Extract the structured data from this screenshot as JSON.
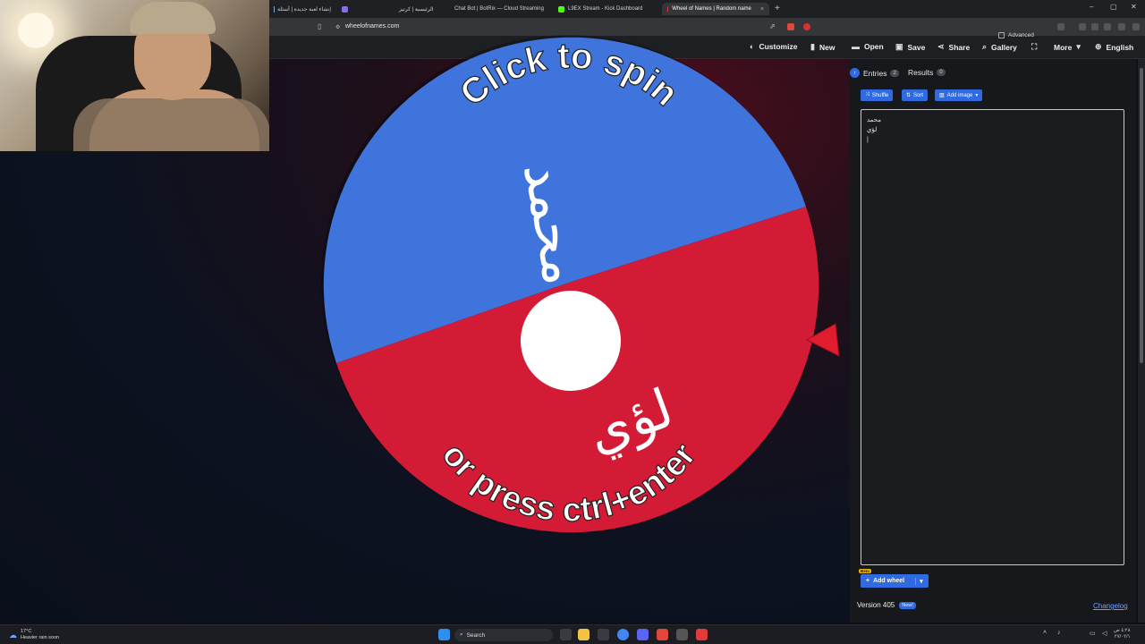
{
  "browser": {
    "tabs": [
      {
        "label": "إنشاء لعبة جديدة | أسئلة",
        "fav": "#7fa6e8"
      },
      {
        "label": "",
        "fav": "#8a6de9"
      },
      {
        "label": "الرئيسية | كرتيز",
        "fav": "#6e6e6e"
      },
      {
        "label": "Chat Bot | BotRix — Cloud Streaming",
        "fav": "#cfcfcf"
      },
      {
        "label": "L9EX Stream - Kick Dashboard",
        "fav": "#53fc18"
      },
      {
        "label": "Wheel of Names | Random name",
        "fav": "#e23a3a"
      }
    ],
    "active_tab_close": "×",
    "new_tab": "+",
    "url": "wheelofnames.com",
    "window_controls": [
      "–",
      "▢",
      "✕"
    ]
  },
  "header": {
    "items": [
      {
        "label": "Customize",
        "icon": "palette-icon",
        "glyph": "◐"
      },
      {
        "label": "New",
        "icon": "file-icon",
        "glyph": "▮"
      },
      {
        "label": "Open",
        "icon": "folder-icon",
        "glyph": "▬"
      },
      {
        "label": "Save",
        "icon": "save-icon",
        "glyph": "▣"
      },
      {
        "label": "Share",
        "icon": "share-icon",
        "glyph": "⋖"
      },
      {
        "label": "Gallery",
        "icon": "search-icon",
        "glyph": "⌕"
      },
      {
        "label": "",
        "icon": "fullscreen-icon",
        "glyph": "⛶"
      },
      {
        "label": "More",
        "icon": "chevron-down-icon",
        "glyph": "▾"
      },
      {
        "label": "English",
        "icon": "globe-icon",
        "glyph": "⊕"
      }
    ]
  },
  "wheel": {
    "top_text": "Click to spin",
    "bottom_text": "or press ctrl+enter",
    "segments": [
      {
        "name": "محمد",
        "color": "#3f74dc"
      },
      {
        "name": "لؤي",
        "color": "#d31b35"
      }
    ],
    "pointer_color": "#e01c2e"
  },
  "panel": {
    "tabs": [
      {
        "label": "Entries",
        "count": "2",
        "icon": "chevron-right-icon"
      },
      {
        "label": "Results",
        "count": "0"
      }
    ],
    "buttons": [
      {
        "label": "Shuffle",
        "icon": "shuffle-icon",
        "glyph": "⤨"
      },
      {
        "label": "Sort",
        "icon": "sort-icon",
        "glyph": "⇅"
      },
      {
        "label": "Add image",
        "icon": "image-icon",
        "glyph": "▧"
      }
    ],
    "advanced_label": "Advanced",
    "entries": [
      "محمد",
      "لؤي"
    ],
    "add_wheel_label": "Add wheel",
    "beta_label": "Beta",
    "version_label": "Version 405",
    "new_badge": "New!",
    "changelog_label": "Changelog"
  },
  "taskbar": {
    "weather_temp": "17°C",
    "weather_desc": "Heavier rain soon",
    "search_label": "Search",
    "clock_time": "٤:٢٨ ص",
    "clock_date": "٢٧/٠٢/١"
  }
}
